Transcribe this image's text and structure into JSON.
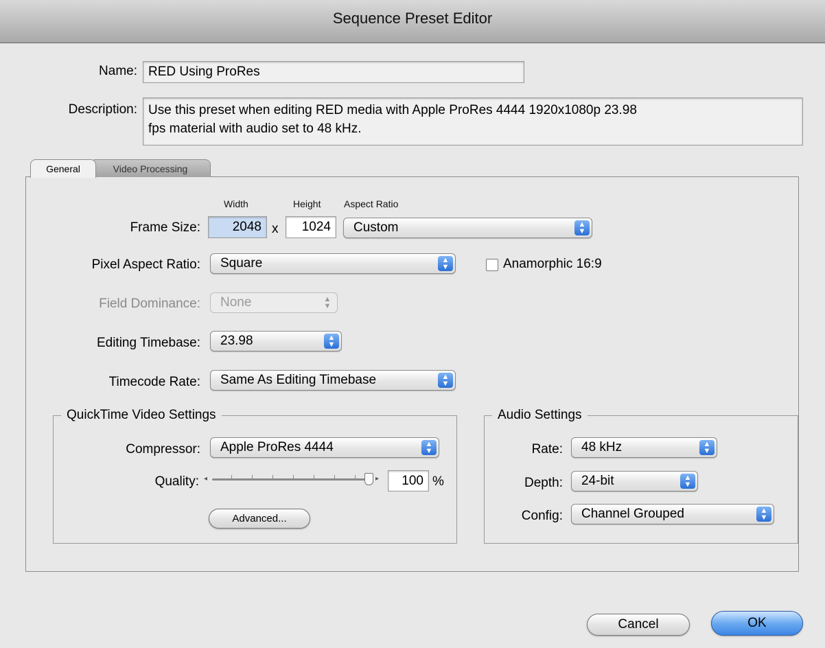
{
  "window": {
    "title": "Sequence Preset Editor"
  },
  "name": {
    "label": "Name:",
    "value": "RED Using ProRes"
  },
  "description": {
    "label": "Description:",
    "line1": "Use this preset when editing RED media with Apple ProRes 4444 1920x1080p 23.98",
    "line2": "fps material with audio set to 48 kHz."
  },
  "tabs": [
    {
      "label": "General"
    },
    {
      "label": "Video Processing"
    }
  ],
  "general": {
    "frame_size": {
      "label": "Frame Size:",
      "width_header": "Width",
      "height_header": "Height",
      "aspect_header": "Aspect Ratio",
      "width": "2048",
      "x": "x",
      "height": "1024",
      "aspect_ratio": "Custom"
    },
    "pixel_aspect_ratio": {
      "label": "Pixel Aspect Ratio:",
      "value": "Square"
    },
    "anamorphic": {
      "label": "Anamorphic 16:9",
      "checked": false
    },
    "field_dominance": {
      "label": "Field Dominance:",
      "value": "None"
    },
    "editing_timebase": {
      "label": "Editing Timebase:",
      "value": "23.98"
    },
    "timecode_rate": {
      "label": "Timecode Rate:",
      "value": "Same As Editing Timebase"
    },
    "quicktime": {
      "title": "QuickTime Video Settings",
      "compressor_label": "Compressor:",
      "compressor": "Apple ProRes 4444",
      "quality_label": "Quality:",
      "quality": "100",
      "quality_unit": "%",
      "advanced_label": "Advanced..."
    },
    "audio": {
      "title": "Audio Settings",
      "rate_label": "Rate:",
      "rate": "48 kHz",
      "depth_label": "Depth:",
      "depth": "24-bit",
      "config_label": "Config:",
      "config": "Channel Grouped"
    }
  },
  "buttons": {
    "cancel": "Cancel",
    "ok": "OK"
  }
}
